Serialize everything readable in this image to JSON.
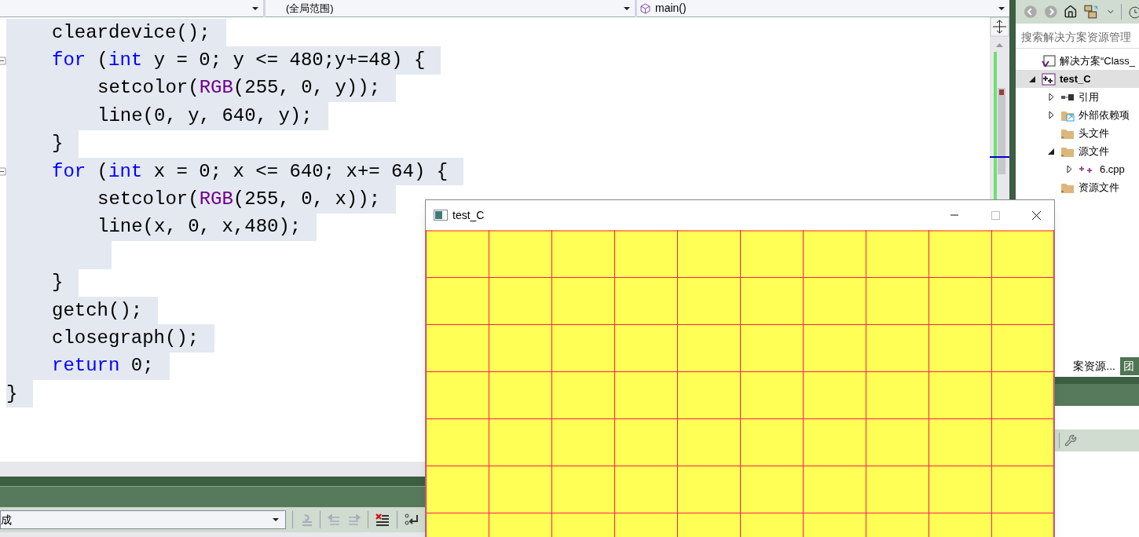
{
  "scope_bar": {
    "scope": "(全局范围)",
    "member": "main()"
  },
  "code_lines": [
    {
      "kind": "outer",
      "fold_marker": false,
      "selected": true,
      "tokens": [
        {
          "kind": "plain",
          "text": "cleardevice();"
        }
      ]
    },
    {
      "kind": "outer",
      "fold_marker": true,
      "selected": true,
      "tokens": [
        {
          "kind": "keyword",
          "text": "for"
        },
        {
          "kind": "plain",
          "text": " ("
        },
        {
          "kind": "keyword",
          "text": "int"
        },
        {
          "kind": "plain",
          "text": " y = 0; y <= 480;y+=48) {"
        }
      ]
    },
    {
      "kind": "inner",
      "fold_marker": false,
      "selected": true,
      "tokens": [
        {
          "kind": "plain",
          "text": "setcolor("
        },
        {
          "kind": "macro",
          "text": "RGB"
        },
        {
          "kind": "plain",
          "text": "(255, 0, y));"
        }
      ]
    },
    {
      "kind": "inner",
      "fold_marker": false,
      "selected": true,
      "tokens": [
        {
          "kind": "plain",
          "text": "line(0, y, 640, y);"
        }
      ]
    },
    {
      "kind": "outer",
      "fold_marker": false,
      "selected": true,
      "tokens": [
        {
          "kind": "plain",
          "text": "}"
        }
      ]
    },
    {
      "kind": "outer",
      "fold_marker": true,
      "selected": true,
      "tokens": [
        {
          "kind": "keyword",
          "text": "for"
        },
        {
          "kind": "plain",
          "text": " ("
        },
        {
          "kind": "keyword",
          "text": "int"
        },
        {
          "kind": "plain",
          "text": " x = 0; x <= 640; x+= 64) {"
        }
      ]
    },
    {
      "kind": "inner",
      "fold_marker": false,
      "selected": true,
      "tokens": [
        {
          "kind": "plain",
          "text": "setcolor("
        },
        {
          "kind": "macro",
          "text": "RGB"
        },
        {
          "kind": "plain",
          "text": "(255, 0, x));"
        }
      ]
    },
    {
      "kind": "inner",
      "fold_marker": false,
      "selected": true,
      "tokens": [
        {
          "kind": "plain",
          "text": "line(x, 0, x,480);"
        }
      ]
    },
    {
      "kind": "blank",
      "fold_marker": false,
      "selected": true
    },
    {
      "kind": "outer",
      "fold_marker": false,
      "selected": true,
      "tokens": [
        {
          "kind": "plain",
          "text": "}"
        }
      ]
    },
    {
      "kind": "outer",
      "fold_marker": false,
      "selected": true,
      "tokens": [
        {
          "kind": "plain",
          "text": "getch();"
        }
      ]
    },
    {
      "kind": "outer",
      "fold_marker": false,
      "selected": true,
      "tokens": [
        {
          "kind": "plain",
          "text": "closegraph();"
        }
      ]
    },
    {
      "kind": "outer",
      "fold_marker": false,
      "selected": true,
      "tokens": [
        {
          "kind": "keyword",
          "text": "return"
        },
        {
          "kind": "plain",
          "text": " 0;"
        }
      ]
    },
    {
      "kind": "root",
      "fold_marker": false,
      "selected": true,
      "tokens": [
        {
          "kind": "plain",
          "text": "}"
        }
      ]
    }
  ],
  "output_panel": {
    "dropdown": "成"
  },
  "solution_explorer": {
    "search": {
      "placeholder": "搜索解决方案资源管理"
    },
    "tree": [
      {
        "label": "解决方案“Class_",
        "kind": "solution",
        "selected": false,
        "children": [
          {
            "label": "test_C",
            "kind": "project",
            "selected": true,
            "expanded": true,
            "children": [
              {
                "label": "引用",
                "kind": "references",
                "selected": false,
                "expanded": false
              },
              {
                "label": "外部依赖项",
                "kind": "external",
                "selected": false,
                "expanded": false
              },
              {
                "label": "头文件",
                "kind": "folder",
                "selected": false
              },
              {
                "label": "源文件",
                "kind": "folder",
                "selected": false,
                "expanded": true,
                "children": [
                  {
                    "label": "6.cpp",
                    "kind": "file",
                    "selected": false,
                    "expanded": false
                  }
                ]
              },
              {
                "label": "资源文件",
                "kind": "folder",
                "selected": false
              }
            ]
          }
        ]
      }
    ],
    "tabs": [
      {
        "label": "案资源...",
        "selected": true
      },
      {
        "label": "团",
        "selected": false
      }
    ]
  },
  "graphics_window": {
    "title": "test_C"
  }
}
